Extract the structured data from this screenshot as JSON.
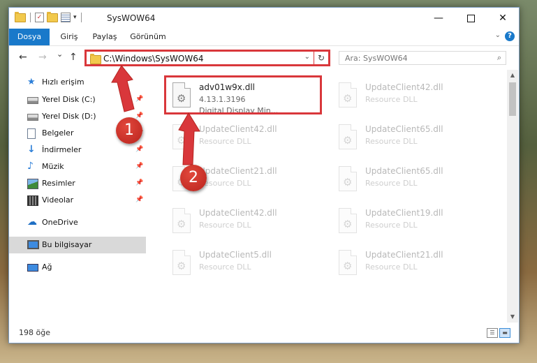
{
  "window": {
    "title": "SysWOW64",
    "controls": {
      "minimize": "—",
      "maximize": "",
      "close": "✕"
    }
  },
  "ribbon": {
    "tabs": [
      "Dosya",
      "Giriş",
      "Paylaş",
      "Görünüm"
    ],
    "active_tab": "Dosya",
    "expand_icon": "chevron-down-icon",
    "help_label": "?"
  },
  "navigation": {
    "back": "←",
    "forward": "→",
    "recent": "⌄",
    "up": "↑",
    "address": "C:\\Windows\\SysWOW64",
    "address_chevron": "⌄",
    "refresh": "↻",
    "search_placeholder": "Ara: SysWOW64",
    "search_icon": "⌕"
  },
  "sidebar": {
    "items": [
      {
        "label": "Hızlı erişim",
        "icon": "star-icon",
        "pinned": false
      },
      {
        "label": "Yerel Disk (C:)",
        "icon": "drive-icon",
        "pinned": true
      },
      {
        "label": "Yerel Disk (D:)",
        "icon": "drive-icon",
        "pinned": true
      },
      {
        "label": "Belgeler",
        "icon": "document-icon",
        "pinned": true
      },
      {
        "label": "İndirmeler",
        "icon": "download-icon",
        "pinned": true
      },
      {
        "label": "Müzik",
        "icon": "music-icon",
        "pinned": true
      },
      {
        "label": "Resimler",
        "icon": "pictures-icon",
        "pinned": true
      },
      {
        "label": "Videolar",
        "icon": "video-icon",
        "pinned": true
      },
      {
        "label": "OneDrive",
        "icon": "cloud-icon",
        "pinned": false
      },
      {
        "label": "Bu bilgisayar",
        "icon": "computer-icon",
        "pinned": false,
        "selected": true
      },
      {
        "label": "Ağ",
        "icon": "network-icon",
        "pinned": false
      }
    ],
    "pin_glyph": "📌"
  },
  "files": {
    "left_column": [
      {
        "name": "adv01w9x.dll",
        "version": "4.13.1.3196",
        "description": "Digital Display Min...",
        "highlighted": true
      },
      {
        "name": "UpdateClient42.dll",
        "description": "Resource DLL"
      },
      {
        "name": "UpdateClient21.dll",
        "description": "Resource DLL"
      },
      {
        "name": "UpdateClient42.dll",
        "description": "Resource DLL"
      },
      {
        "name": "UpdateClient5.dll",
        "description": "Resource DLL"
      }
    ],
    "right_column": [
      {
        "name": "UpdateClient42.dll",
        "description": "Resource DLL"
      },
      {
        "name": "UpdateClient65.dll",
        "description": "Resource DLL"
      },
      {
        "name": "UpdateClient65.dll",
        "description": "Resource DLL"
      },
      {
        "name": "UpdateClient19.dll",
        "description": "Resource DLL"
      },
      {
        "name": "UpdateClient21.dll",
        "description": "Resource DLL"
      }
    ]
  },
  "status": {
    "item_count": "198 öğe"
  },
  "annotations": {
    "badge_1": "1",
    "badge_2": "2",
    "color": "#d9373b"
  },
  "colors": {
    "accent": "#1979ca",
    "highlight": "#d9373b",
    "selected_row": "#d9d9d9"
  }
}
